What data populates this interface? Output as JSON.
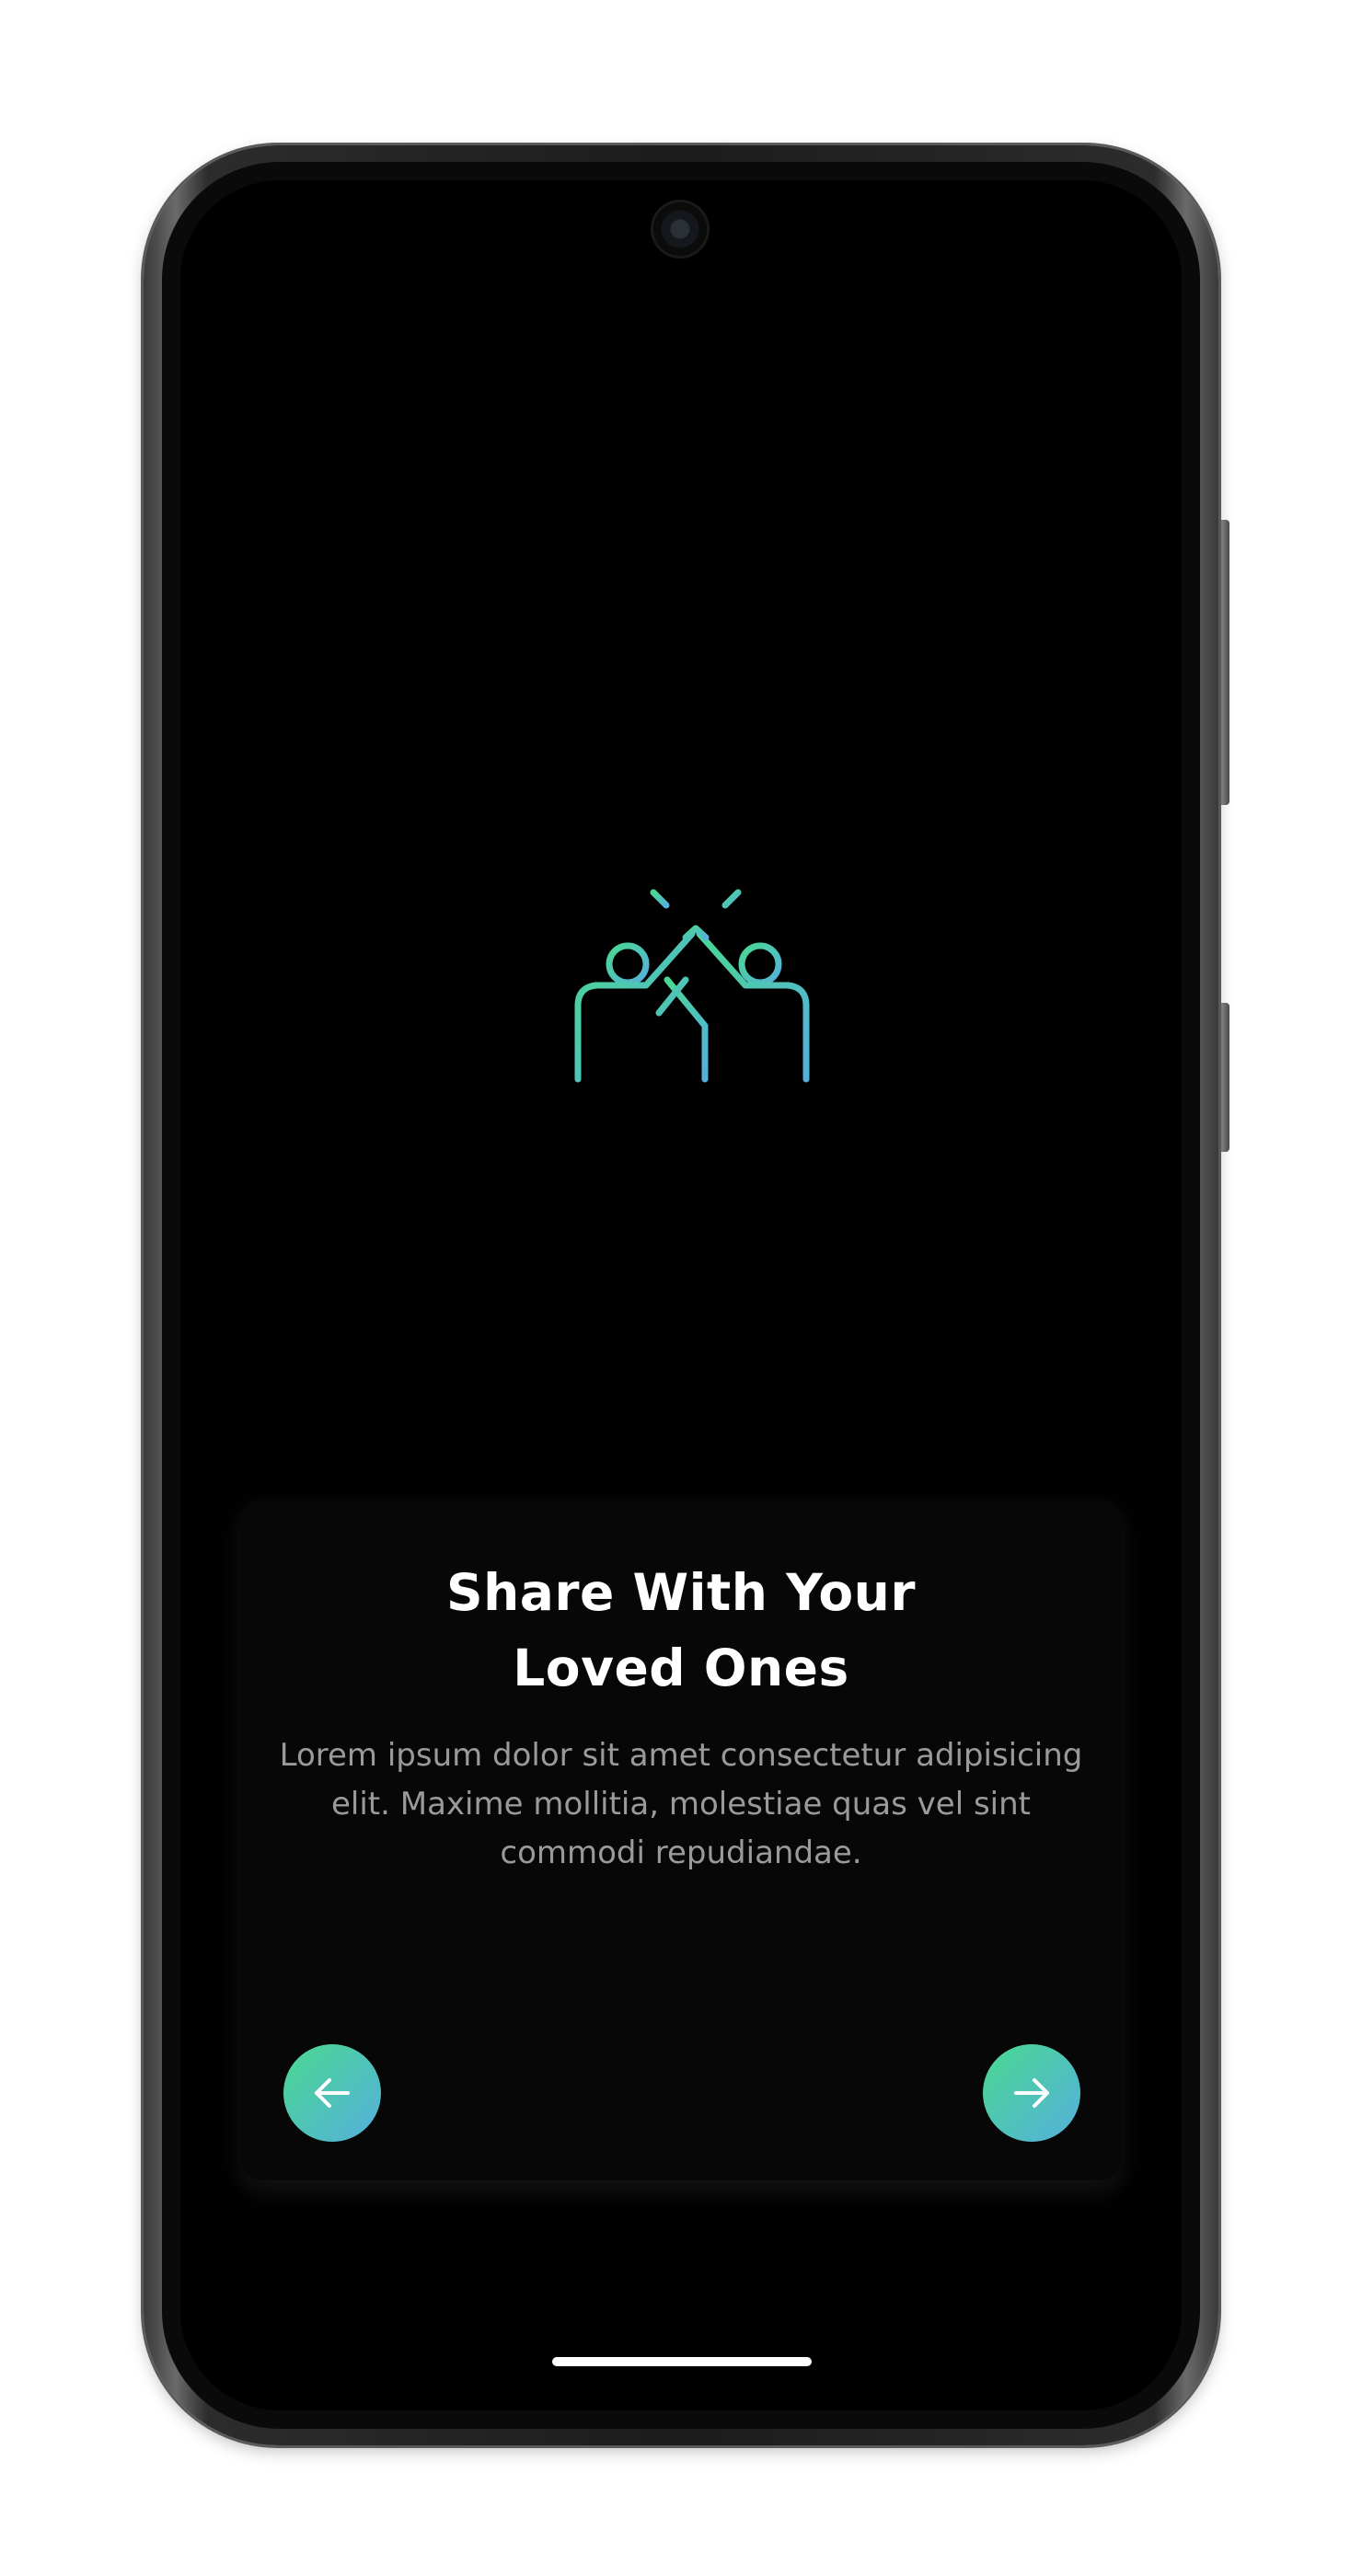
{
  "onboarding": {
    "icon": "high-five-icon",
    "title": "Share With Your\nLoved Ones",
    "description": "Lorem ipsum dolor sit amet consectetur adipisicing elit. Maxime mollitia, molestiae quas vel sint commodi repudiandae.",
    "prev_button": "arrow-left-icon",
    "next_button": "arrow-right-icon"
  },
  "colors": {
    "background": "#000000",
    "card": "#070707",
    "accent_start": "#4ad890",
    "accent_end": "#54b0dc",
    "title": "#ffffff",
    "body": "#9a9a9a"
  }
}
